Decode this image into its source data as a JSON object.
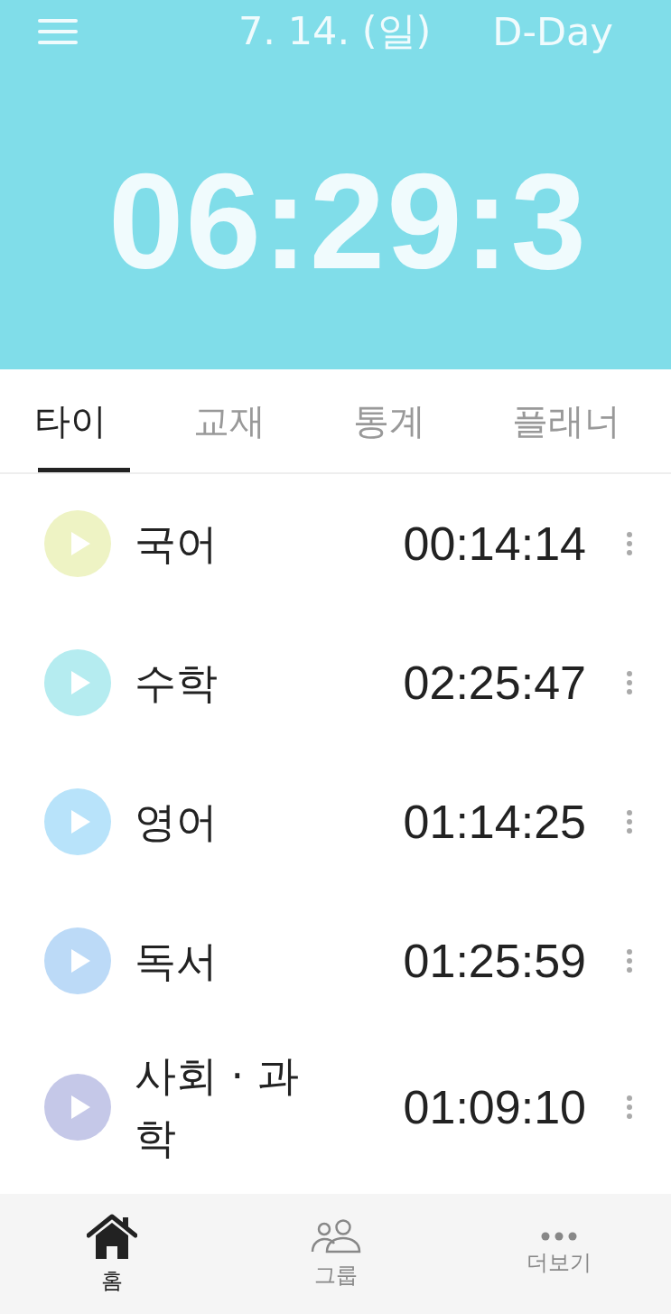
{
  "header": {
    "date": "7. 14. (일)",
    "dday": "D-Day",
    "total_time": "06:29:3"
  },
  "tabs": [
    {
      "label": "타이",
      "selected": true
    },
    {
      "label": "교재",
      "selected": false
    },
    {
      "label": "통계",
      "selected": false
    },
    {
      "label": "플래너",
      "selected": false
    }
  ],
  "subjects": [
    {
      "name": "국어",
      "time": "00:14:14",
      "color": "#eef3c4"
    },
    {
      "name": "수학",
      "time": "02:25:47",
      "color": "#b5ecf0"
    },
    {
      "name": "영어",
      "time": "01:14:25",
      "color": "#b8e3fa"
    },
    {
      "name": "독서",
      "time": "01:25:59",
      "color": "#bcdaf7"
    },
    {
      "name": "사회 · 과학",
      "time": "01:09:10",
      "color": "#c5c8e8"
    }
  ],
  "bottom_nav": [
    {
      "kind": "home",
      "label": "홈",
      "selected": true
    },
    {
      "kind": "group",
      "label": "그룹",
      "selected": false
    },
    {
      "kind": "more",
      "label": "더보기",
      "selected": false
    }
  ]
}
